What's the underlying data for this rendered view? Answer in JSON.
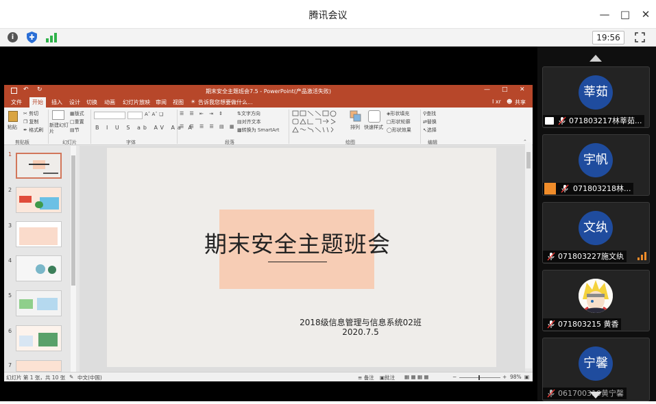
{
  "window": {
    "title": "腾讯会议"
  },
  "toolbar": {
    "clock": "19:56"
  },
  "ppt": {
    "title": "期末安全主题班会7.5 - PowerPoint(产品激活失败)",
    "tabs": [
      "文件",
      "开始",
      "插入",
      "设计",
      "切换",
      "动画",
      "幻灯片放映",
      "审阅",
      "视图"
    ],
    "tell_me": "告诉我您想要做什么...",
    "user": "I xr",
    "share": "共享",
    "ribbon": {
      "paste": "粘贴",
      "cut": "剪切",
      "copy": "复制",
      "format_painter": "格式刷",
      "new_slide": "新建幻灯片",
      "layout": "版式",
      "reset": "重置",
      "section": "节",
      "text_direction": "文字方向",
      "align_text": "对齐文本",
      "smartart": "转换为 SmartArt",
      "arrange": "排列",
      "quick_styles": "快速样式",
      "shape_fill": "形状填充",
      "shape_outline": "形状轮廓",
      "shape_effects": "形状效果",
      "find": "查找",
      "replace": "替换",
      "select": "选择",
      "groups": [
        "剪贴板",
        "幻灯片",
        "字体",
        "段落",
        "绘图",
        "编辑"
      ]
    },
    "thumbnails": [
      "1",
      "2",
      "3",
      "4",
      "5",
      "6",
      "7"
    ],
    "slide": {
      "title": "期末安全主题班会",
      "class": "2018级信息管理与信息系统02班",
      "date": "2020.7.5"
    },
    "status": {
      "slide_info": "幻灯片 第 1 张，共 10 张",
      "language": "中文(中国)",
      "notes": "备注",
      "comments": "批注",
      "zoom": "98%"
    }
  },
  "participants": [
    {
      "avatar": "莘茹",
      "name": "071803217林莘茹..."
    },
    {
      "avatar": "宇帆",
      "name": "071803218林..."
    },
    {
      "avatar": "文纨",
      "name": "071803227施文纨"
    },
    {
      "avatar": "",
      "name": "071803215 黄香"
    },
    {
      "avatar": "宁馨",
      "name": "061700310黄宁馨"
    }
  ],
  "colors": {
    "ppt_accent": "#b7472a",
    "avatar_bg": "#1f4c9e",
    "slide_box": "#f7cdb5"
  }
}
